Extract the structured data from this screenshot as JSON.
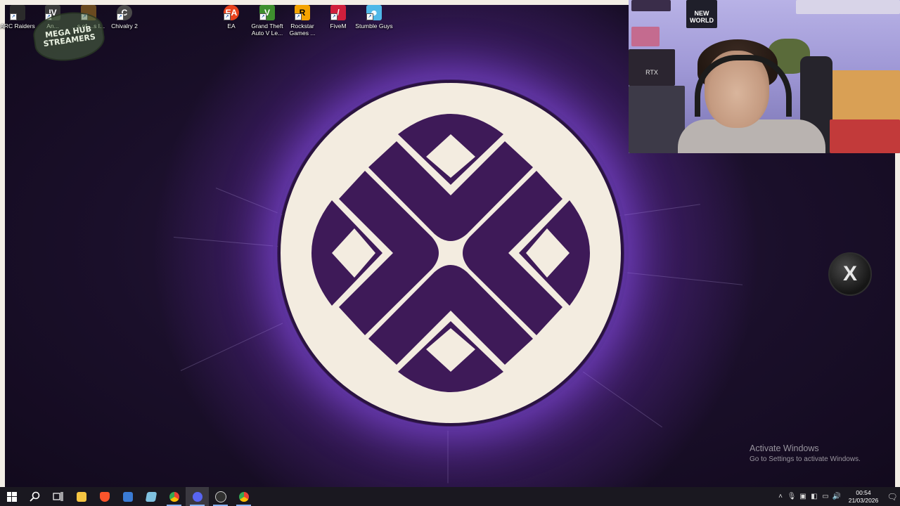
{
  "desktop_icons": [
    {
      "label": "ARC Raiders",
      "icon": "arc-raiders-icon",
      "color": "#2b2b2b"
    },
    {
      "label": "An...",
      "icon": "anno-icon",
      "color": "#3a3a3a"
    },
    {
      "label": "...s of ...s I...",
      "icon": "age-of-empires-icon",
      "color": "#6a4a20"
    },
    {
      "label": "Chivalry 2",
      "icon": "chivalry-icon",
      "color": "#4a4a4a"
    },
    {
      "label": "EA",
      "icon": "ea-icon",
      "color": "#e8421c"
    },
    {
      "label": "Grand Theft Auto V Le...",
      "icon": "gta-v-icon",
      "color": "#3e8f2e"
    },
    {
      "label": "Rockstar Games ...",
      "icon": "rockstar-icon",
      "color": "#f4a300"
    },
    {
      "label": "FiveM",
      "icon": "fivem-icon",
      "color": "#d01f3c"
    },
    {
      "label": "Stumble Guys",
      "icon": "stumble-guys-icon",
      "color": "#4fb8e8"
    }
  ],
  "overlay_logo": {
    "text": "MEGA HUB STREAMERS"
  },
  "webcam": {
    "poster_text": "NEW WORLD",
    "poster_text_2": "RTX"
  },
  "float_button": {
    "glyph": "X"
  },
  "activate_windows": {
    "title": "Activate Windows",
    "subtitle": "Go to Settings to activate Windows."
  },
  "taskbar": {
    "apps": [
      {
        "name": "file-explorer",
        "color": "#f5c542"
      },
      {
        "name": "brave",
        "color": "#fb542b"
      },
      {
        "name": "store",
        "color": "#3a7bd5"
      },
      {
        "name": "notes",
        "color": "#7fc1e0"
      },
      {
        "name": "chrome",
        "color": "#4caf50"
      },
      {
        "name": "discord",
        "color": "#5865f2"
      },
      {
        "name": "obs",
        "color": "#303030"
      },
      {
        "name": "chrome-2",
        "color": "#4caf50"
      }
    ],
    "time": "00:54",
    "date": "21/03/2026"
  },
  "colors": {
    "emblem_light": "#f3ece0",
    "emblem_dark": "#3e1a58",
    "background": "#1a0f2a"
  }
}
